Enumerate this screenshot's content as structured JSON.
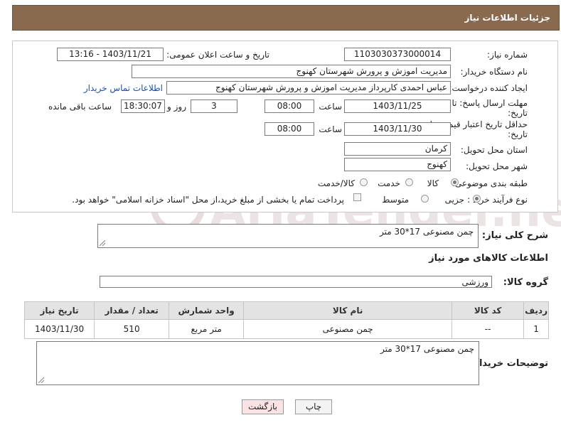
{
  "header": {
    "title": "جزئیات اطلاعات نیاز"
  },
  "form": {
    "need_number": {
      "label": "شماره نیاز:",
      "value": "1103030373000014"
    },
    "announce": {
      "label": "تاریخ و ساعت اعلان عمومی:",
      "value": "1403/11/21 - 13:16"
    },
    "buyer_org": {
      "label": "نام دستگاه خریدار:",
      "value": "مدیریت اموزش و پرورش شهرستان کهنوج"
    },
    "requester": {
      "label": "ایجاد کننده درخواست:",
      "value": "عباس احمدی کارپرداز مدیریت اموزش و پرورش شهرستان کهنوج",
      "contact_link": "اطلاعات تماس خریدار"
    },
    "deadline": {
      "label_line1": "مهلت ارسال پاسخ: تا",
      "label_line2": "تاریخ:",
      "date": "1403/11/25",
      "time_label": "ساعت",
      "time": "08:00",
      "days": "3",
      "days_label": "روز و",
      "remaining": "18:30:07",
      "remaining_label": "ساعت باقی مانده"
    },
    "validity": {
      "label_line1": "حداقل تاریخ اعتبار قیمت: تا",
      "label_line2": "تاریخ:",
      "date": "1403/11/30",
      "time_label": "ساعت",
      "time": "08:00"
    },
    "province": {
      "label": "استان محل تحویل:",
      "value": "کرمان"
    },
    "city": {
      "label": "شهر محل تحویل:",
      "value": "کهنوج"
    },
    "category": {
      "label": "طبقه بندی موضوعی:",
      "options": [
        "کالا",
        "خدمت",
        "کالا/خدمت"
      ],
      "selected": "کالا"
    },
    "purchase_type": {
      "label": "نوع فرآیند خرید :",
      "options": [
        "جزیی",
        "متوسط"
      ],
      "selected": "جزیی",
      "payment_note": "پرداخت تمام یا بخشی از مبلغ خرید،از محل \"اسناد خزانه اسلامی\" خواهد بود."
    }
  },
  "summary": {
    "label": "شرح کلی نیاز:",
    "value": "چمن مصنوعی 17*30 متر"
  },
  "items_section": {
    "title": "اطلاعات کالاهای مورد نیاز"
  },
  "goods_group": {
    "label": "گروه کالا:",
    "value": "ورزشی"
  },
  "table": {
    "columns": [
      "ردیف",
      "کد کالا",
      "نام کالا",
      "واحد شمارش",
      "تعداد / مقدار",
      "تاریخ نیاز"
    ],
    "rows": [
      [
        "1",
        "--",
        "چمن مصنوعی",
        "متر مربع",
        "510",
        "1403/11/30"
      ]
    ]
  },
  "buyer_notes": {
    "label": "توضیحات خریدار:",
    "value": "چمن مصنوعی 17*30 متر"
  },
  "buttons": {
    "print": "چاپ",
    "back": "بازگشت"
  },
  "watermark": {
    "text": "AriaTender.net"
  },
  "colors": {
    "header_bg": "#8a6a4e",
    "link": "#1a4fb0",
    "back_button_bg": "#fbe3e3"
  }
}
